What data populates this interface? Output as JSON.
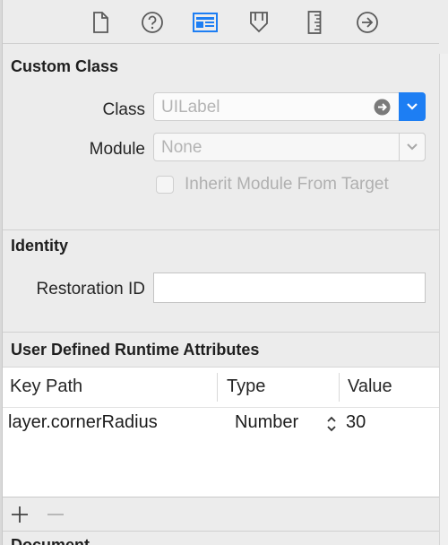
{
  "toolbar": {
    "tabs": [
      {
        "name": "file-inspector",
        "icon": "document-icon",
        "active": false
      },
      {
        "name": "quick-help",
        "icon": "question-icon",
        "active": false
      },
      {
        "name": "identity-inspector",
        "icon": "identity-card-icon",
        "active": true
      },
      {
        "name": "attributes-inspector",
        "icon": "attributes-icon",
        "active": false
      },
      {
        "name": "size-inspector",
        "icon": "ruler-icon",
        "active": false
      },
      {
        "name": "connections-inspector",
        "icon": "arrow-circle-icon",
        "active": false
      }
    ],
    "active_color": "#1d7ef3"
  },
  "custom_class": {
    "title": "Custom Class",
    "class_label": "Class",
    "class_placeholder": "UILabel",
    "module_label": "Module",
    "module_placeholder": "None",
    "inherit_label": "Inherit Module From Target",
    "inherit_checked": false
  },
  "identity": {
    "title": "Identity",
    "restoration_label": "Restoration ID",
    "restoration_value": ""
  },
  "runtime_attributes": {
    "title": "User Defined Runtime Attributes",
    "columns": [
      "Key Path",
      "Type",
      "Value"
    ],
    "rows": [
      {
        "key_path": "layer.cornerRadius",
        "type": "Number",
        "value": "30"
      }
    ]
  },
  "document": {
    "title": "Document"
  }
}
